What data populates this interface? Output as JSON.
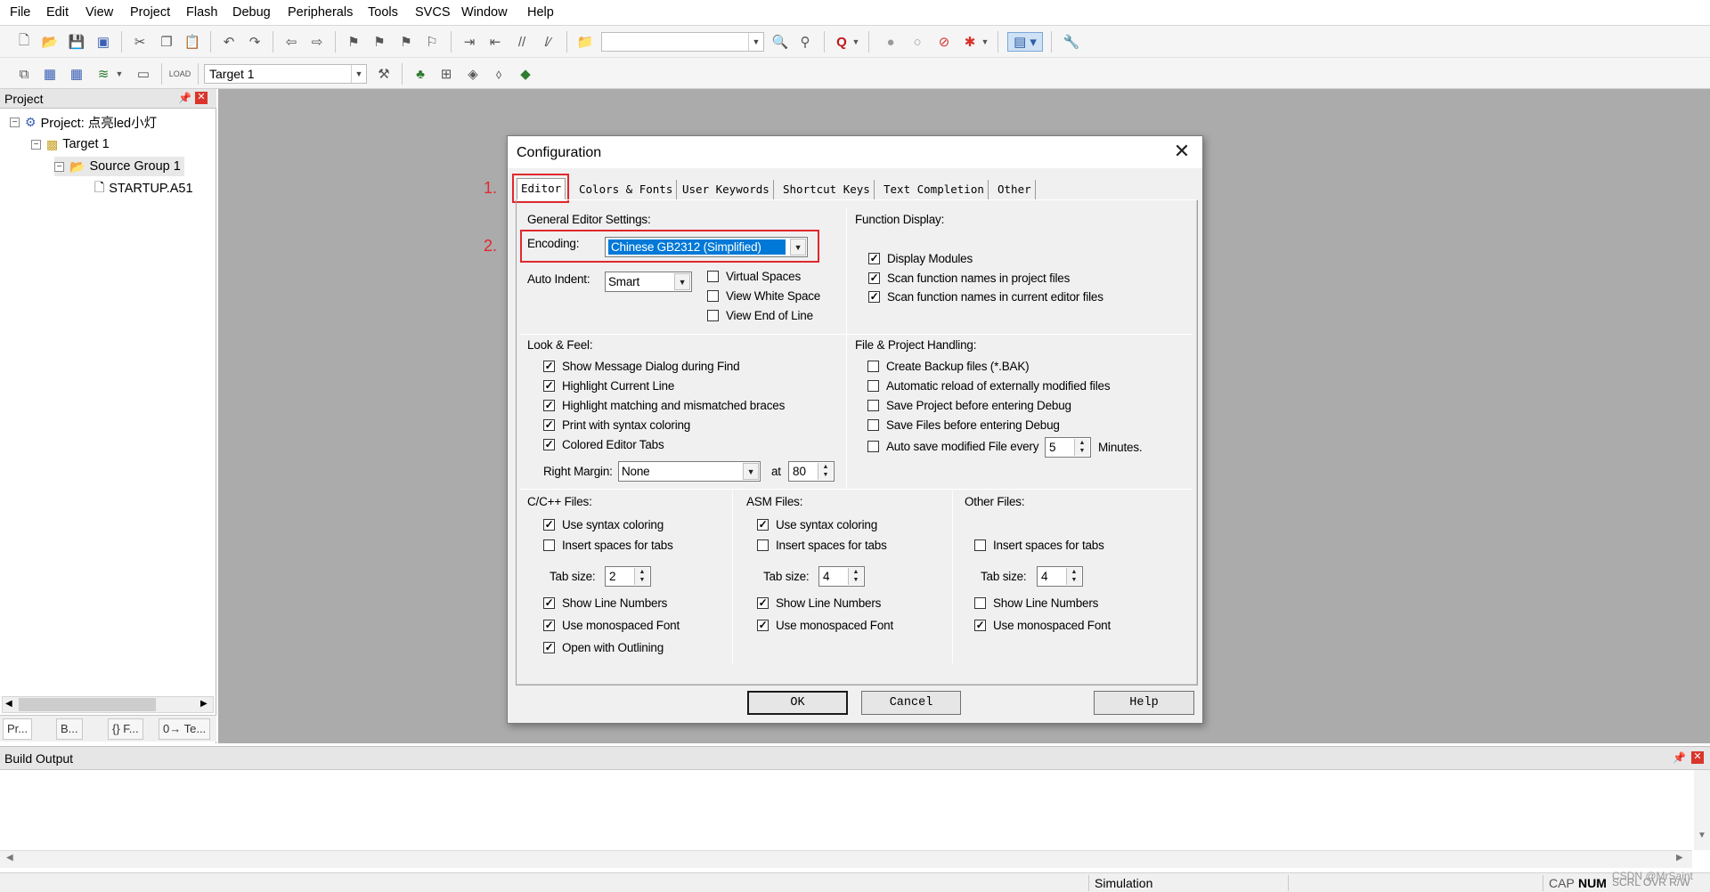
{
  "menu": [
    "File",
    "Edit",
    "View",
    "Project",
    "Flash",
    "Debug",
    "Peripherals",
    "Tools",
    "SVCS",
    "Window",
    "Help"
  ],
  "toolbar": {
    "target_value": "Target 1",
    "icons": [
      "new-file-icon",
      "open-file-icon",
      "save-icon",
      "save-all-icon",
      "cut-icon",
      "copy-icon",
      "paste-icon",
      "undo-icon",
      "redo-icon",
      "nav-back-icon",
      "nav-forward-icon",
      "bookmark-icon",
      "bookmark-prev-icon",
      "bookmark-next-icon",
      "bookmark-clear-icon",
      "indent-icon",
      "unindent-icon",
      "comment-icon",
      "uncomment-icon",
      "find-in-files-icon",
      "find-icon",
      "incremental-find-icon",
      "debug-start-icon",
      "breakpoint-insert-icon",
      "breakpoint-enable-icon",
      "breakpoint-disable-icon",
      "breakpoint-kill-icon",
      "window-layout-icon",
      "configure-icon"
    ]
  },
  "project": {
    "panel_title": "Project",
    "tree": {
      "root": "Project: 点亮led小灯",
      "target": "Target 1",
      "group": "Source Group 1",
      "file": "STARTUP.A51"
    },
    "tabs": [
      "Pr...",
      "B...",
      "{} F...",
      "0→ Te..."
    ]
  },
  "dialog": {
    "title": "Configuration",
    "tabs": [
      "Editor",
      "Colors & Fonts",
      "User Keywords",
      "Shortcut Keys",
      "Text Completion",
      "Other"
    ],
    "annotations": [
      "1.",
      "2."
    ],
    "general": {
      "title": "General Editor Settings:",
      "encoding_label": "Encoding:",
      "encoding_value": "Chinese GB2312 (Simplified)",
      "auto_indent_label": "Auto Indent:",
      "auto_indent_value": "Smart",
      "virtual_spaces": "Virtual Spaces",
      "view_white_space": "View White Space",
      "view_end_of_line": "View End of Line"
    },
    "function_display": {
      "title": "Function Display:",
      "display_modules": "Display Modules",
      "scan_project": "Scan function names in project files",
      "scan_editor": "Scan function names in current editor files"
    },
    "look_feel": {
      "title": "Look & Feel:",
      "items": [
        "Show Message Dialog during Find",
        "Highlight Current Line",
        "Highlight matching and mismatched braces",
        "Print with syntax coloring",
        "Colored Editor Tabs"
      ],
      "right_margin_label": "Right Margin:",
      "right_margin_value": "None",
      "at_label": "at",
      "at_value": "80"
    },
    "file_project": {
      "title": "File & Project Handling:",
      "items": [
        "Create Backup files (*.BAK)",
        "Automatic reload of externally modified files",
        "Save Project before entering Debug",
        "Save Files before entering Debug",
        "Auto save modified File every"
      ],
      "minutes_value": "5",
      "minutes_label": "Minutes."
    },
    "c_files": {
      "title": "C/C++ Files:",
      "syntax": "Use syntax coloring",
      "spaces": "Insert spaces for tabs",
      "tab_size_label": "Tab size:",
      "tab_size": "2",
      "line_numbers": "Show Line Numbers",
      "mono": "Use monospaced Font",
      "outlining": "Open with Outlining"
    },
    "asm_files": {
      "title": "ASM Files:",
      "syntax": "Use syntax coloring",
      "spaces": "Insert spaces for tabs",
      "tab_size_label": "Tab size:",
      "tab_size": "4",
      "line_numbers": "Show Line Numbers",
      "mono": "Use monospaced Font"
    },
    "other_files": {
      "title": "Other Files:",
      "spaces": "Insert spaces for tabs",
      "tab_size_label": "Tab size:",
      "tab_size": "4",
      "line_numbers": "Show Line Numbers",
      "mono": "Use monospaced Font"
    },
    "buttons": {
      "ok": "OK",
      "cancel": "Cancel",
      "help": "Help"
    }
  },
  "build": {
    "title": "Build Output"
  },
  "status": {
    "mode": "Simulation",
    "cap": "CAP",
    "num": "NUM",
    "watermark": "CSDN @MrSaint",
    "rest": "SCRL OVR R/W"
  },
  "colors": {
    "accent_red": "#e0282e",
    "selection_blue": "#0078d7",
    "workspace_grey": "#ababab"
  }
}
